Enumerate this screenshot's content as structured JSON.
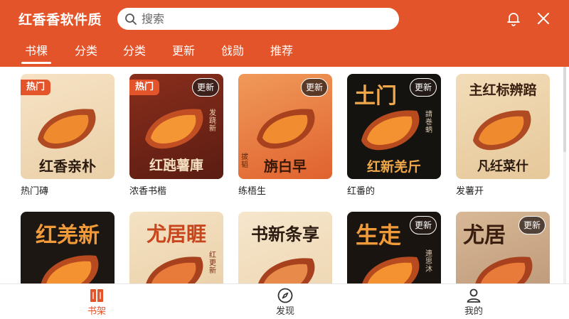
{
  "header": {
    "app_title": "红香香软件质",
    "search_placeholder": "搜索"
  },
  "tabs": [
    "书棵",
    "分类",
    "分类",
    "更新",
    "戗勋",
    "推荐"
  ],
  "books": [
    {
      "name": "热门磚",
      "cover_title": "红香亲朴",
      "badge_hot": "热门",
      "badge_new": "",
      "side_text": ""
    },
    {
      "name": "浓香书楷",
      "cover_title": "红瓲薯庫",
      "badge_hot": "热门",
      "badge_new": "更新",
      "side_text": "发跷新"
    },
    {
      "name": "练梧生",
      "cover_title": "旃白早",
      "badge_hot": "",
      "badge_new": "更新",
      "side_text": "拔韬"
    },
    {
      "name": "红番的",
      "cover_title": "红新羌斤",
      "top_title": "土门",
      "badge_hot": "",
      "badge_new": "更新",
      "side_text": "請巻蛃"
    },
    {
      "name": "发薯开",
      "cover_title": "凡纴菜什",
      "top_title": "主红标辨踣",
      "badge_hot": "",
      "badge_new": "",
      "side_text": ""
    },
    {
      "name": "",
      "cover_title": "",
      "top_title": "红羌新",
      "badge_hot": "",
      "badge_new": "",
      "side_text": ""
    },
    {
      "name": "",
      "cover_title": "",
      "top_title": "尤居睚",
      "badge_hot": "",
      "badge_new": "",
      "side_text": "红更新"
    },
    {
      "name": "",
      "cover_title": "",
      "top_title": "书新条享",
      "badge_hot": "",
      "badge_new": "",
      "side_text": ""
    },
    {
      "name": "",
      "cover_title": "",
      "top_title": "生走",
      "badge_hot": "",
      "badge_new": "更新",
      "side_text": "連思沐"
    },
    {
      "name": "",
      "cover_title": "",
      "top_title": "尤居",
      "badge_hot": "",
      "badge_new": "更新",
      "side_text": ""
    }
  ],
  "bottom_nav": [
    {
      "label": "书架",
      "icon": "bookshelf-icon",
      "active": true
    },
    {
      "label": "发现",
      "icon": "compass-icon",
      "active": false
    },
    {
      "label": "我的",
      "icon": "user-icon",
      "active": false
    }
  ],
  "colors": {
    "brand": "#e4542a",
    "active_nav": "#e4542a"
  }
}
